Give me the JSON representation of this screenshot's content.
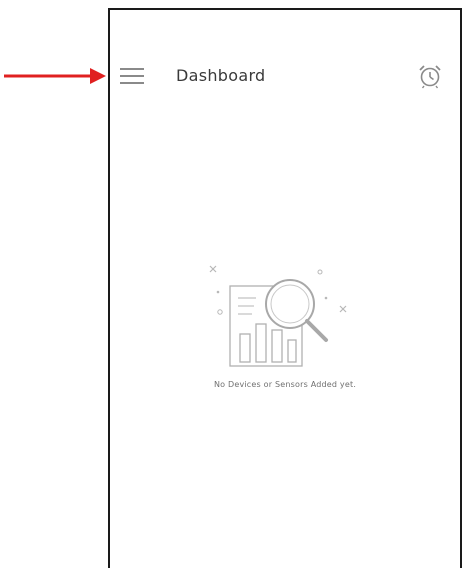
{
  "header": {
    "title": "Dashboard",
    "menu_icon": "hamburger-menu-icon",
    "alarm_icon": "alarm-clock-icon"
  },
  "empty_state": {
    "message": "No Devices or Sensors Added yet.",
    "illustration_icon": "magnifier-over-bar-chart-icon"
  },
  "colors": {
    "annotation_arrow": "#e02020",
    "icon_gray": "#8a8a8a",
    "title_text": "#3a3a3a",
    "frame_border": "#1a1a1a"
  }
}
